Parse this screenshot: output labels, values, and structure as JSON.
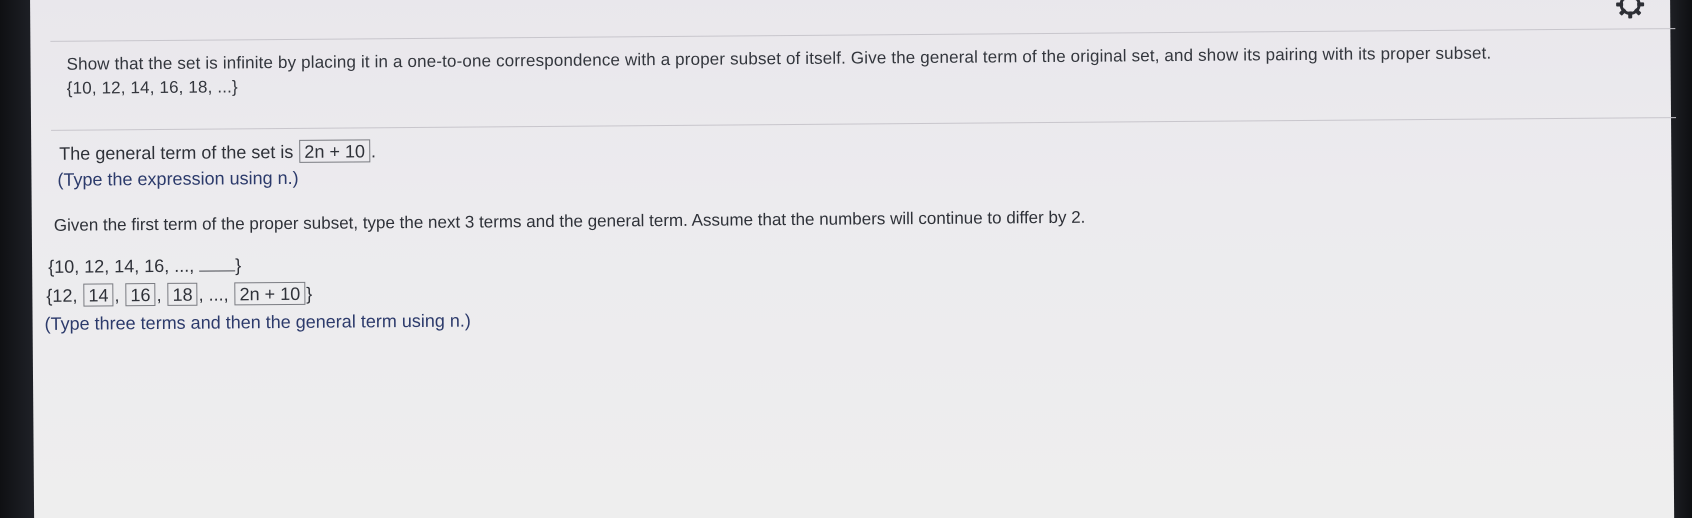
{
  "settings": {
    "icon": "gear-icon"
  },
  "question": {
    "prompt": "Show that the set is infinite by placing it in a one-to-one correspondence with a proper subset of itself. Give the general term of the original set, and show its pairing with its proper subset.",
    "set": "{10, 12, 14, 16, 18, ...}"
  },
  "part1": {
    "text_before": "The general term of the set is",
    "answer": "2n + 10",
    "text_after": ".",
    "instruction": "(Type the expression using n.)"
  },
  "part2": {
    "prompt": "Given the first term of the proper subset, type the next 3 terms and the general term. Assume that the numbers will continue to differ by  2.",
    "original_set_prefix": "{10, 12, 14, 16, ...,",
    "original_set_suffix": "}",
    "subset_prefix": "{12,",
    "terms": [
      "14",
      "16",
      "18"
    ],
    "separator": ",",
    "ellipsis": ", ...,",
    "general_term": "2n + 10",
    "subset_suffix": "}",
    "instruction": "(Type three terms and then the general term using n.)"
  },
  "colors": {
    "instruction_text": "#2c3a6b",
    "body_text": "#2e3138",
    "page_background": "#ecebee"
  }
}
